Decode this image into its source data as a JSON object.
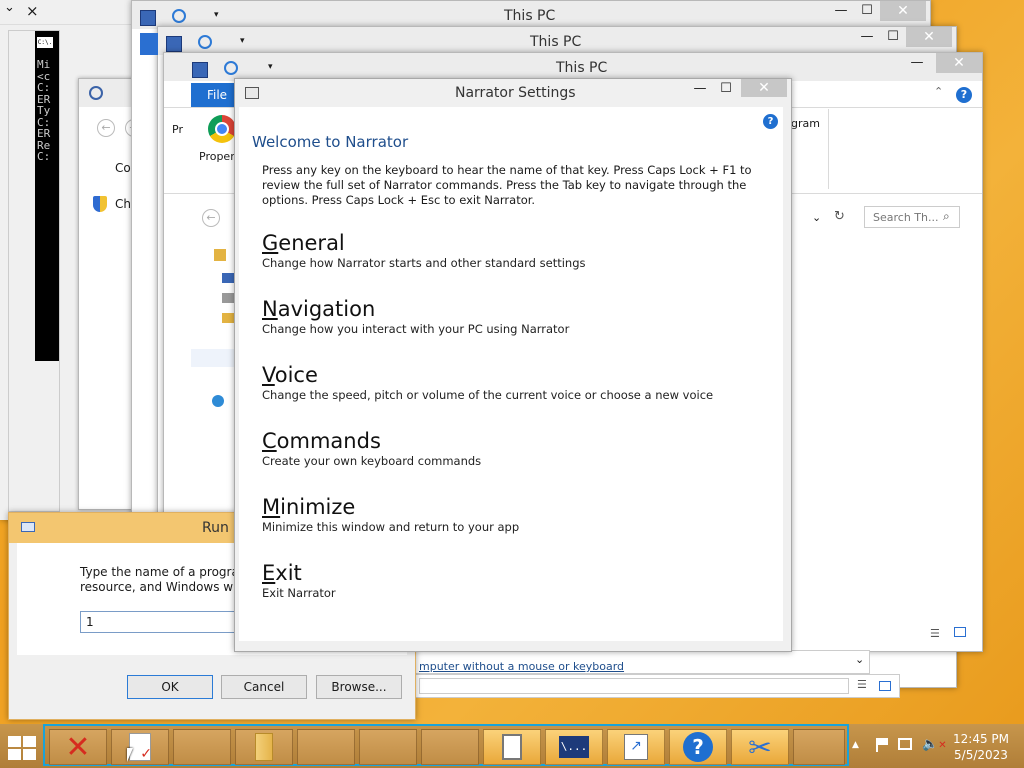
{
  "top_left_window": {
    "close_glyph": "×",
    "chevron_glyph": "⌄"
  },
  "cmd_lines": [
    "Mi",
    "<c",
    "",
    "C:",
    "ER",
    "Ty",
    "",
    "C:",
    "ER",
    "Re",
    "",
    "C:"
  ],
  "cmd_icon_label": "C:\\.",
  "control_window": {
    "link1": "Control",
    "link2": "Change"
  },
  "explorer_windows": [
    {
      "title": "This PC"
    },
    {
      "title": "This PC"
    },
    {
      "title": "This PC"
    }
  ],
  "explorer_front": {
    "file_tab": "File",
    "pr_fragment": "Pr",
    "properties_label": "Proper",
    "program_fragment": "gram",
    "search_placeholder": "Search Th...",
    "bottom_link": "mputer without a mouse or keyboard"
  },
  "narrator": {
    "title": "Narrator Settings",
    "heading": "Welcome to Narrator",
    "intro": "Press any key on the keyboard to hear the name of that key.  Press Caps Lock + F1 to review the full set of Narrator commands.  Press the Tab key to navigate through the options.  Press Caps Lock + Esc to exit Narrator.",
    "help_glyph": "?",
    "items": [
      {
        "key": "G",
        "rest": "eneral",
        "desc": "Change how Narrator starts and other standard settings"
      },
      {
        "key": "N",
        "rest": "avigation",
        "desc": "Change how you interact with your PC using Narrator"
      },
      {
        "key": "V",
        "rest": "oice",
        "desc": "Change the speed, pitch or volume of the current voice or choose a new voice"
      },
      {
        "key": "C",
        "rest": "ommands",
        "desc": "Create your own keyboard commands"
      },
      {
        "key": "M",
        "rest": "inimize",
        "desc": "Minimize this window and return to your app"
      },
      {
        "key": "E",
        "rest": "xit",
        "desc": "Exit Narrator"
      }
    ]
  },
  "run_dialog": {
    "title": "Run",
    "desc_line1": "Type the name of a program,",
    "desc_line2": "resource, and Windows will o",
    "input_value": "1",
    "ok": "OK",
    "cancel": "Cancel",
    "browse": "Browse..."
  },
  "window_controls": {
    "minimize": "—",
    "maximize": "☐",
    "close": "✕"
  },
  "taskbar": {
    "time": "12:45 PM",
    "date": "5/5/2023",
    "up_arrow": "▲",
    "cmd_label": "\\..."
  },
  "colors": {
    "accent": "#1aa3d9",
    "narrator_heading": "#1f4e8c",
    "taskbar": "#b07e38"
  }
}
